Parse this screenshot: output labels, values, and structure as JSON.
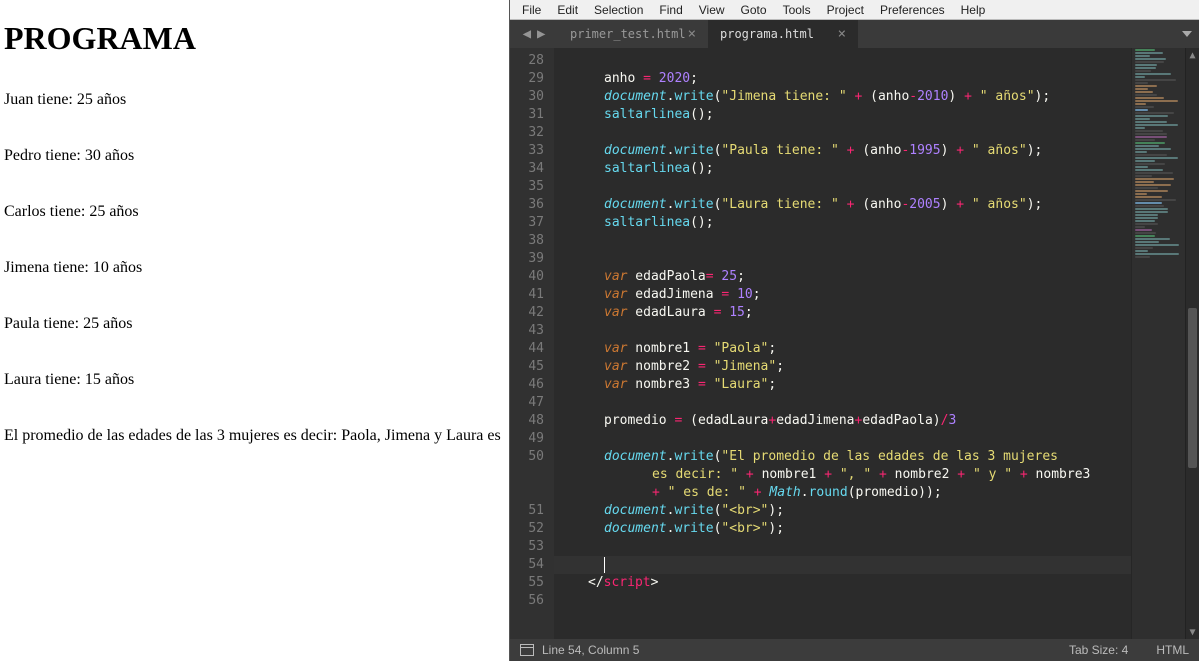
{
  "browser": {
    "title": "PROGRAMA",
    "lines": [
      "Juan tiene: 25 años",
      "Pedro tiene: 30 años",
      "Carlos tiene: 25 años",
      "Jimena tiene: 10 años",
      "Paula tiene: 25 años",
      "Laura tiene: 15 años",
      "El promedio de las edades de las 3 mujeres es decir: Paola, Jimena y Laura es"
    ]
  },
  "editor": {
    "menu": [
      "File",
      "Edit",
      "Selection",
      "Find",
      "View",
      "Goto",
      "Tools",
      "Project",
      "Preferences",
      "Help"
    ],
    "tabs": [
      {
        "label": "primer_test.html",
        "active": false
      },
      {
        "label": "programa.html",
        "active": true
      }
    ],
    "first_line_number": 28,
    "code_lines": [
      [
        [
          "",
          44
        ]
      ],
      [
        [
          "",
          44
        ],
        [
          "id",
          "anho "
        ],
        [
          "op",
          "="
        ],
        [
          "id",
          " "
        ],
        [
          "num",
          "2020"
        ],
        [
          "pn",
          ";"
        ]
      ],
      [
        [
          "",
          44
        ],
        [
          "obj",
          "document"
        ],
        [
          "pn",
          "."
        ],
        [
          "fn",
          "write"
        ],
        [
          "pn",
          "("
        ],
        [
          "str",
          "\"Jimena tiene: \""
        ],
        [
          "id",
          " "
        ],
        [
          "op",
          "+"
        ],
        [
          "id",
          " "
        ],
        [
          "pn",
          "("
        ],
        [
          "id",
          "anho"
        ],
        [
          "op",
          "-"
        ],
        [
          "num",
          "2010"
        ],
        [
          "pn",
          ")"
        ],
        [
          "id",
          " "
        ],
        [
          "op",
          "+"
        ],
        [
          "id",
          " "
        ],
        [
          "str",
          "\" años\""
        ],
        [
          "pn",
          ")"
        ],
        [
          "pn",
          ";"
        ]
      ],
      [
        [
          "",
          44
        ],
        [
          "fn",
          "saltarlinea"
        ],
        [
          "pn",
          "("
        ],
        [
          "pn",
          ")"
        ],
        [
          "pn",
          ";"
        ]
      ],
      [
        [
          "",
          0
        ]
      ],
      [
        [
          "",
          44
        ],
        [
          "obj",
          "document"
        ],
        [
          "pn",
          "."
        ],
        [
          "fn",
          "write"
        ],
        [
          "pn",
          "("
        ],
        [
          "str",
          "\"Paula tiene: \""
        ],
        [
          "id",
          " "
        ],
        [
          "op",
          "+"
        ],
        [
          "id",
          " "
        ],
        [
          "pn",
          "("
        ],
        [
          "id",
          "anho"
        ],
        [
          "op",
          "-"
        ],
        [
          "num",
          "1995"
        ],
        [
          "pn",
          ")"
        ],
        [
          "id",
          " "
        ],
        [
          "op",
          "+"
        ],
        [
          "id",
          " "
        ],
        [
          "str",
          "\" años\""
        ],
        [
          "pn",
          ")"
        ],
        [
          "pn",
          ";"
        ]
      ],
      [
        [
          "",
          44
        ],
        [
          "fn",
          "saltarlinea"
        ],
        [
          "pn",
          "("
        ],
        [
          "pn",
          ")"
        ],
        [
          "pn",
          ";"
        ]
      ],
      [
        [
          "",
          0
        ]
      ],
      [
        [
          "",
          44
        ],
        [
          "obj",
          "document"
        ],
        [
          "pn",
          "."
        ],
        [
          "fn",
          "write"
        ],
        [
          "pn",
          "("
        ],
        [
          "str",
          "\"Laura tiene: \""
        ],
        [
          "id",
          " "
        ],
        [
          "op",
          "+"
        ],
        [
          "id",
          " "
        ],
        [
          "pn",
          "("
        ],
        [
          "id",
          "anho"
        ],
        [
          "op",
          "-"
        ],
        [
          "num",
          "2005"
        ],
        [
          "pn",
          ")"
        ],
        [
          "id",
          " "
        ],
        [
          "op",
          "+"
        ],
        [
          "id",
          " "
        ],
        [
          "str",
          "\" años\""
        ],
        [
          "pn",
          ")"
        ],
        [
          "pn",
          ";"
        ]
      ],
      [
        [
          "",
          44
        ],
        [
          "fn",
          "saltarlinea"
        ],
        [
          "pn",
          "("
        ],
        [
          "pn",
          ")"
        ],
        [
          "pn",
          ";"
        ]
      ],
      [
        [
          "",
          0
        ]
      ],
      [
        [
          "",
          0
        ]
      ],
      [
        [
          "",
          44
        ],
        [
          "kw",
          "var"
        ],
        [
          "id",
          " edadPaola"
        ],
        [
          "op",
          "="
        ],
        [
          "id",
          " "
        ],
        [
          "num",
          "25"
        ],
        [
          "pn",
          ";"
        ]
      ],
      [
        [
          "",
          44
        ],
        [
          "kw",
          "var"
        ],
        [
          "id",
          " edadJimena "
        ],
        [
          "op",
          "="
        ],
        [
          "id",
          " "
        ],
        [
          "num",
          "10"
        ],
        [
          "pn",
          ";"
        ]
      ],
      [
        [
          "",
          44
        ],
        [
          "kw",
          "var"
        ],
        [
          "id",
          " edadLaura "
        ],
        [
          "op",
          "="
        ],
        [
          "id",
          " "
        ],
        [
          "num",
          "15"
        ],
        [
          "pn",
          ";"
        ]
      ],
      [
        [
          "",
          0
        ]
      ],
      [
        [
          "",
          44
        ],
        [
          "kw",
          "var"
        ],
        [
          "id",
          " nombre1 "
        ],
        [
          "op",
          "="
        ],
        [
          "id",
          " "
        ],
        [
          "str",
          "\"Paola\""
        ],
        [
          "pn",
          ";"
        ]
      ],
      [
        [
          "",
          44
        ],
        [
          "kw",
          "var"
        ],
        [
          "id",
          " nombre2 "
        ],
        [
          "op",
          "="
        ],
        [
          "id",
          " "
        ],
        [
          "str",
          "\"Jimena\""
        ],
        [
          "pn",
          ";"
        ]
      ],
      [
        [
          "",
          44
        ],
        [
          "kw",
          "var"
        ],
        [
          "id",
          " nombre3 "
        ],
        [
          "op",
          "="
        ],
        [
          "id",
          " "
        ],
        [
          "str",
          "\"Laura\""
        ],
        [
          "pn",
          ";"
        ]
      ],
      [
        [
          "",
          0
        ]
      ],
      [
        [
          "",
          44
        ],
        [
          "id",
          "promedio "
        ],
        [
          "op",
          "="
        ],
        [
          "id",
          " "
        ],
        [
          "pn",
          "("
        ],
        [
          "id",
          "edadLaura"
        ],
        [
          "op",
          "+"
        ],
        [
          "id",
          "edadJimena"
        ],
        [
          "op",
          "+"
        ],
        [
          "id",
          "edadPaola"
        ],
        [
          "pn",
          ")"
        ],
        [
          "op",
          "/"
        ],
        [
          "num",
          "3"
        ]
      ],
      [
        [
          "",
          0
        ]
      ],
      [
        [
          "",
          44
        ],
        [
          "obj",
          "document"
        ],
        [
          "pn",
          "."
        ],
        [
          "fn",
          "write"
        ],
        [
          "pn",
          "("
        ],
        [
          "str",
          "\"El promedio de las edades de las 3 mujeres "
        ]
      ],
      [
        [
          "",
          92
        ],
        [
          "str",
          "es decir: \""
        ],
        [
          "id",
          " "
        ],
        [
          "op",
          "+"
        ],
        [
          "id",
          " nombre1 "
        ],
        [
          "op",
          "+"
        ],
        [
          "id",
          " "
        ],
        [
          "str",
          "\", \""
        ],
        [
          "id",
          " "
        ],
        [
          "op",
          "+"
        ],
        [
          "id",
          " nombre2 "
        ],
        [
          "op",
          "+"
        ],
        [
          "id",
          " "
        ],
        [
          "str",
          "\" y \""
        ],
        [
          "id",
          " "
        ],
        [
          "op",
          "+"
        ],
        [
          "id",
          " nombre3"
        ]
      ],
      [
        [
          "",
          92
        ],
        [
          "op",
          "+"
        ],
        [
          "id",
          " "
        ],
        [
          "str",
          "\" es de: \""
        ],
        [
          "id",
          " "
        ],
        [
          "op",
          "+"
        ],
        [
          "id",
          " "
        ],
        [
          "obj",
          "Math"
        ],
        [
          "pn",
          "."
        ],
        [
          "fn",
          "round"
        ],
        [
          "pn",
          "("
        ],
        [
          "id",
          "promedio"
        ],
        [
          "pn",
          ")"
        ],
        [
          "pn",
          ")"
        ],
        [
          "pn",
          ";"
        ]
      ],
      [
        [
          "",
          44
        ],
        [
          "obj",
          "document"
        ],
        [
          "pn",
          "."
        ],
        [
          "fn",
          "write"
        ],
        [
          "pn",
          "("
        ],
        [
          "str",
          "\"<br>\""
        ],
        [
          "pn",
          ")"
        ],
        [
          "pn",
          ";"
        ]
      ],
      [
        [
          "",
          44
        ],
        [
          "obj",
          "document"
        ],
        [
          "pn",
          "."
        ],
        [
          "fn",
          "write"
        ],
        [
          "pn",
          "("
        ],
        [
          "str",
          "\"<br>\""
        ],
        [
          "pn",
          ")"
        ],
        [
          "pn",
          ";"
        ]
      ],
      [
        [
          "",
          0
        ]
      ],
      [
        [
          "",
          44
        ],
        [
          "cursor",
          ""
        ]
      ],
      [
        [
          "",
          28
        ],
        [
          "ang",
          "</"
        ],
        [
          "tagn",
          "script"
        ],
        [
          "ang",
          ">"
        ]
      ],
      [
        [
          "",
          0
        ]
      ]
    ],
    "wrapped_lines_gutter": [
      "28",
      "29",
      "30",
      "31",
      "32",
      "33",
      "34",
      "35",
      "36",
      "37",
      "38",
      "39",
      "40",
      "41",
      "42",
      "43",
      "44",
      "45",
      "46",
      "47",
      "48",
      "49",
      "50",
      "",
      "",
      "51",
      "52",
      "53",
      "54",
      "55",
      "56"
    ],
    "status": {
      "pos": "Line 54, Column 5",
      "tab": "Tab Size: 4",
      "lang": "HTML"
    }
  }
}
